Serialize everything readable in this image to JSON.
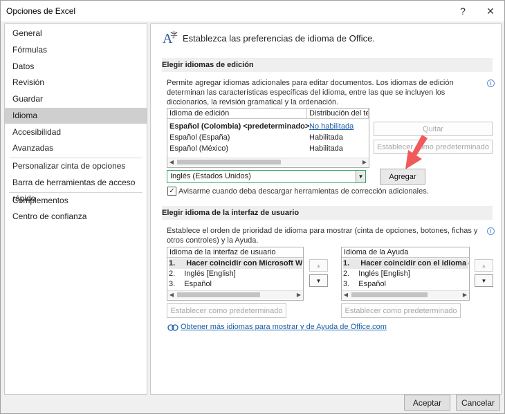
{
  "window": {
    "title": "Opciones de Excel",
    "help_glyph": "?",
    "close_glyph": "✕"
  },
  "sidebar": {
    "items": [
      {
        "label": "General"
      },
      {
        "label": "Fórmulas"
      },
      {
        "label": "Datos"
      },
      {
        "label": "Revisión"
      },
      {
        "label": "Guardar"
      },
      {
        "label": "Idioma",
        "selected": true
      },
      {
        "label": "Accesibilidad"
      },
      {
        "label": "Avanzadas"
      },
      {
        "label": "Personalizar cinta de opciones"
      },
      {
        "label": "Barra de herramientas de acceso rápido"
      },
      {
        "label": "Complementos"
      },
      {
        "label": "Centro de confianza"
      }
    ]
  },
  "header": {
    "icon": "language-icon",
    "text": "Establezca las preferencias de idioma de Office."
  },
  "editing": {
    "section_title": "Elegir idiomas de edición",
    "description": "Permite agregar idiomas adicionales para editar documentos. Los idiomas de edición determinan las características específicas del idioma, entre las que se incluyen los diccionarios, la revisión gramatical y la ordenación.",
    "columns": [
      "Idioma de edición",
      "Distribución del te"
    ],
    "rows": [
      {
        "language": "Español (Colombia) <predeterminado>",
        "layout": "No habilitada",
        "bold": true,
        "link": true
      },
      {
        "language": "Español (España)",
        "layout": "Habilitada"
      },
      {
        "language": "Español (México)",
        "layout": "Habilitada"
      }
    ],
    "remove_button": "Quitar",
    "set_default_button": "Establecer como predeterminado",
    "add_combo_value": "Inglés (Estados Unidos)",
    "add_button": "Agregar",
    "notify_checkbox_label": "Avisarme cuando deba descargar herramientas de corrección adicionales.",
    "notify_checked": true
  },
  "ui_language": {
    "section_title": "Elegir idioma de la interfaz de usuario",
    "description": "Establece el orden de prioridad de idioma para mostrar (cinta de opciones, botones, fichas y otros controles) y la Ayuda.",
    "display_header": "Idioma de la interfaz de usuario",
    "display_items": [
      {
        "num": "1.",
        "label": "Hacer coincidir con Microsoft Wind",
        "bold": true
      },
      {
        "num": "2.",
        "label": "Inglés [English]"
      },
      {
        "num": "3.",
        "label": "Español"
      }
    ],
    "help_header": "Idioma de la Ayuda",
    "help_items": [
      {
        "num": "1.",
        "label": "Hacer coincidir con el idioma de",
        "bold": true
      },
      {
        "num": "2.",
        "label": "Inglés [English]"
      },
      {
        "num": "3.",
        "label": "Español"
      }
    ],
    "set_default_display": "Establecer como predeterminado",
    "set_default_help": "Establecer como predeterminado",
    "more_link": "Obtener más idiomas para mostrar y de Ayuda de Office.com"
  },
  "footer": {
    "ok": "Aceptar",
    "cancel": "Cancelar"
  },
  "colors": {
    "accent_link": "#1a5ea8",
    "combo_border": "#3ea66a",
    "arrow_overlay": "#f05a5a"
  }
}
